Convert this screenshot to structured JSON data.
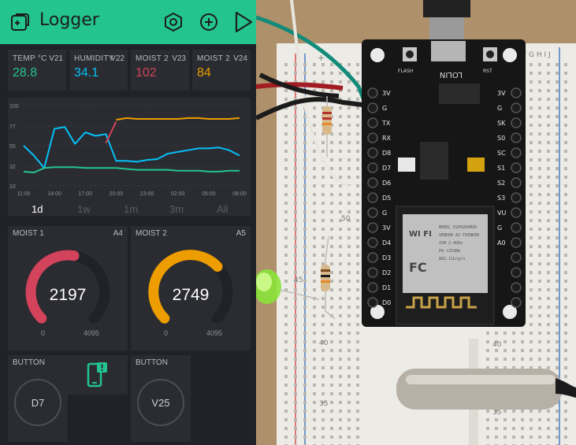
{
  "app": {
    "title": "Logger"
  },
  "value_displays": [
    {
      "label": "TEMP °C",
      "pin": "V21",
      "value": "28.8",
      "color": "#23c48e"
    },
    {
      "label": "HUMIDITY",
      "pin": "V22",
      "value": "34.1",
      "color": "#04c0f8"
    },
    {
      "label": "MOIST 2",
      "pin": "V23",
      "value": "102",
      "color": "#d3435c"
    },
    {
      "label": "MOIST 2",
      "pin": "V24",
      "value": "84",
      "color": "#ed9d00"
    }
  ],
  "chart_data": {
    "type": "line",
    "y_ticks": [
      "100",
      "77",
      "55",
      "32",
      "10"
    ],
    "ylim": [
      10,
      100
    ],
    "x_ticks": [
      "11:00",
      "14:00",
      "17:00",
      "20:00",
      "23:00",
      "02:00",
      "05:00",
      "08:00"
    ],
    "x": [
      0,
      1,
      2,
      3,
      4,
      5,
      6,
      7,
      8,
      9,
      10,
      11,
      12,
      13,
      14,
      15,
      16,
      17,
      18,
      19,
      20,
      21
    ],
    "series": [
      {
        "color": "#04c0f8",
        "values": [
          55,
          44,
          30,
          74,
          76,
          57,
          70,
          66,
          68,
          38,
          38,
          37,
          39,
          40,
          46,
          48,
          50,
          52,
          52,
          53,
          50,
          44
        ]
      },
      {
        "color": "#23c48e",
        "values": [
          26,
          25,
          30,
          31,
          31,
          31,
          30,
          30,
          30,
          30,
          29,
          28,
          28,
          28,
          28,
          27,
          27,
          27,
          26,
          26,
          27,
          27
        ]
      },
      {
        "color": "#d3435c",
        "values": [
          null,
          null,
          null,
          null,
          null,
          null,
          null,
          null,
          58,
          82,
          null,
          null,
          null,
          null,
          null,
          null,
          null,
          null,
          null,
          null,
          null,
          null
        ]
      },
      {
        "color": "#ed9d00",
        "values": [
          null,
          null,
          null,
          null,
          null,
          null,
          null,
          null,
          null,
          84,
          86,
          85,
          85,
          85,
          85,
          85,
          86,
          86,
          85,
          85,
          85,
          86
        ]
      }
    ]
  },
  "periods": [
    "1d",
    "1w",
    "1m",
    "3m",
    "All"
  ],
  "selected_period": "1d",
  "gauges": [
    {
      "label": "MOIST 1",
      "pin": "A4",
      "value": "2197",
      "min": "0",
      "max": "4095",
      "color": "#d3435c",
      "fraction": 0.5365
    },
    {
      "label": "MOIST 2",
      "pin": "A5",
      "value": "2749",
      "min": "0",
      "max": "4095",
      "color": "#ed9d00",
      "fraction": 0.6713
    }
  ],
  "buttons": [
    {
      "label": "BUTTON",
      "pin": "D7"
    },
    {
      "label": "BUTTON",
      "pin": "V25"
    }
  ],
  "photo": {
    "board_top_labels": [
      "FLASH",
      "RST"
    ],
    "board_brand": "LOLIN",
    "board_pins_left": [
      "A0",
      "G",
      "VU",
      "S3",
      "S2",
      "S1",
      "SC",
      "S0",
      "SK",
      "G",
      "3V"
    ],
    "board_pins_right": [
      "D0",
      "D1",
      "D2",
      "D3",
      "D4",
      "3V",
      "G",
      "D5",
      "D6",
      "D7",
      "D8",
      "RX",
      "TX",
      "G",
      "3V"
    ],
    "wifi_label": "WI FI",
    "module_lines": [
      "MODEL ESP8266MOD",
      "VENDOR AI-THINKER",
      "ISM 2.4GHz",
      "PA +25dBm",
      "802.11b/g/n"
    ],
    "fcc_label": "FC",
    "breadboard_row_numbers": [
      "50",
      "45",
      "40",
      "35"
    ],
    "breadboard_col_letters": "F G H I J"
  }
}
